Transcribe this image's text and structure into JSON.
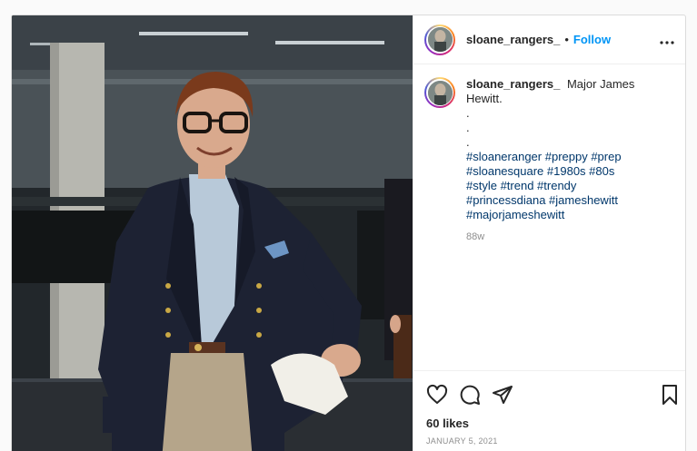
{
  "post": {
    "username": "sloane_rangers_",
    "separator": "•",
    "follow_label": "Follow",
    "more_label": "•••",
    "caption": {
      "text": "Major James Hewitt.",
      "dots": [
        ".",
        ".",
        "."
      ],
      "hashtags": "#sloaneranger #preppy #prep #sloanesquare #1980s #80s #style #trend #trendy #princessdiana #jameshewitt #majorjameshewitt",
      "time_ago": "88w"
    },
    "actions": {
      "like_icon": "heart-icon",
      "comment_icon": "comment-icon",
      "share_icon": "paper-plane-icon",
      "save_icon": "bookmark-icon"
    },
    "likes": "60 likes",
    "date": "JANUARY 5, 2021"
  },
  "colors": {
    "link_blue": "#0095f6",
    "hashtag_blue": "#00376b",
    "muted": "#8e8e8e",
    "text": "#262626"
  }
}
